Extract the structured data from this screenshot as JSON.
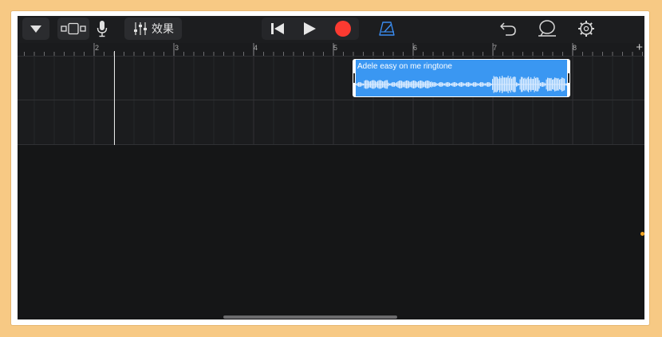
{
  "toolbar": {
    "fx_label": "效果",
    "icons": [
      "dropdown-icon",
      "track-view-icon",
      "microphone-icon",
      "mixer-icon",
      "rewind-icon",
      "play-icon",
      "record-icon",
      "metronome-icon",
      "undo-icon",
      "loop-icon",
      "settings-icon"
    ]
  },
  "ruler": {
    "bars": [
      "2",
      "3",
      "4",
      "5",
      "6",
      "7",
      "8"
    ],
    "add_label": "+"
  },
  "region": {
    "title": "Adele easy on me ringtone",
    "color": "#3a97f2"
  },
  "colors": {
    "record": "#fb3a31",
    "metronome": "#3a8cf0",
    "background": "#151617",
    "frame": "#f7c984"
  }
}
